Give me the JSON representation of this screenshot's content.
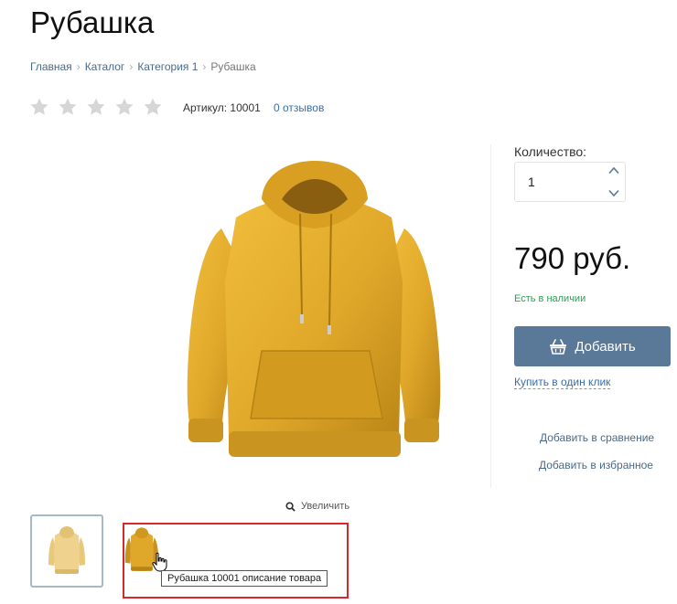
{
  "product": {
    "title": "Рубашка",
    "sku_label": "Артикул:",
    "sku_value": "10001",
    "reviews_label": "0 отзывов",
    "rating": 0,
    "max_rating": 5
  },
  "breadcrumb": [
    {
      "label": "Главная"
    },
    {
      "label": "Каталог"
    },
    {
      "label": "Категория 1"
    },
    {
      "label": "Рубашка"
    }
  ],
  "gallery": {
    "zoom_label": "Увеличить",
    "tooltip": "Рубашка 10001 описание товара"
  },
  "purchase": {
    "quantity_label": "Количество:",
    "quantity_value": "1",
    "price": "790 руб.",
    "stock": "Есть в наличии",
    "add_button": "Добавить",
    "one_click": "Купить в один клик",
    "compare": "Добавить в сравнение",
    "favorite": "Добавить в избранное"
  },
  "colors": {
    "accent": "#5a7898",
    "link": "#3a6ea5",
    "stock": "#2e9e54",
    "highlight": "#d8282e",
    "hoodie": "#e0a82a"
  }
}
